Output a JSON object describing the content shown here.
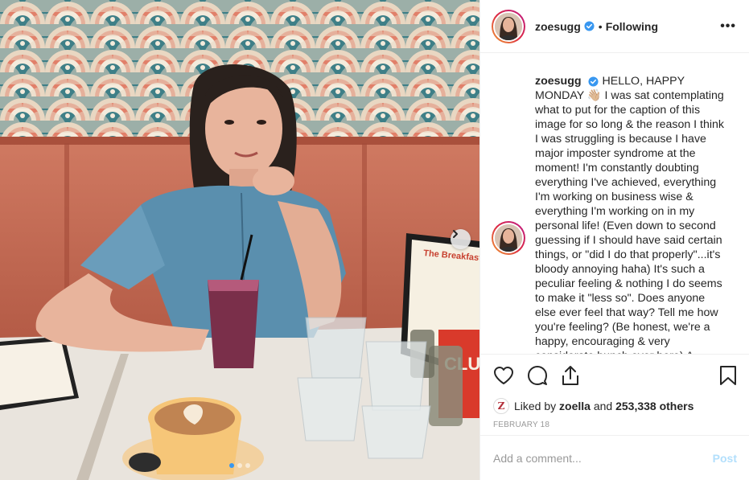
{
  "post": {
    "username": "zoesugg",
    "verified": true,
    "separator": "•",
    "follow_status": "Following",
    "more_label": "•••"
  },
  "caption": {
    "username": "zoesugg",
    "text": "HELLO, HAPPY MONDAY 👋🏼 I was sat contemplating what to put for the caption of this image for so long & the reason I think I was struggling is because I have major imposter syndrome at the moment! I'm constantly doubting everything I've achieved, everything I'm working on business wise & everything I'm working on in my personal life! (Even down to second guessing if I should have said certain things, or \"did I do that properly\"...it's bloody annoying haha) It's such a peculiar feeling & nothing I do seems to make it \"less so\". Does anyone else ever feel that way? Tell me how you're feeling? (Be honest, we're a happy, encouraging & very considerate bunch over here) A"
  },
  "likes": {
    "prefix": "Liked by",
    "user": "zoella",
    "and": "and",
    "count": "253,338 others",
    "badge": "Z"
  },
  "date": "FEBRUARY 18",
  "comment": {
    "placeholder": "Add a comment...",
    "post_label": "Post"
  },
  "photo": {
    "menu_title": "The Breakfast C",
    "menu_side_text": "CLU HO",
    "carousel_dots": 3,
    "active_dot": 1
  },
  "icons": [
    "heart-icon",
    "comment-icon",
    "share-icon",
    "bookmark-icon",
    "chevron-right-icon",
    "verified-icon",
    "more-icon"
  ],
  "colors": {
    "verified_blue": "#3897f0",
    "post_button_disabled": "#b2dffc",
    "booth_red": "#c86f58",
    "wallpaper_teal": "#3e7f87"
  }
}
